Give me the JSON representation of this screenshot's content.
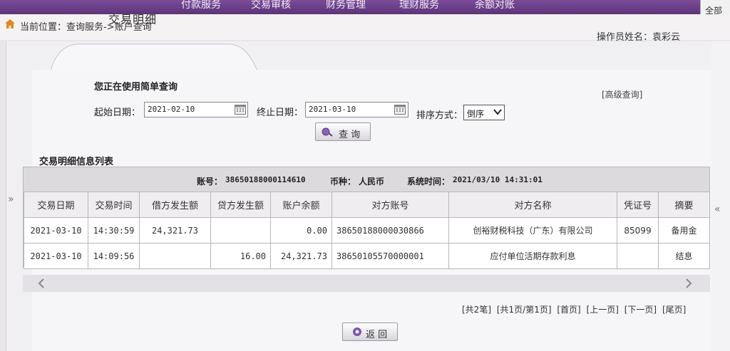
{
  "topnav": {
    "items": [
      "付款服务",
      "交易审核",
      "财务管理",
      "理财服务",
      "余额对账"
    ],
    "right_label": "全部"
  },
  "breadcrumb": {
    "text": "当前位置：查询服务->账户查询"
  },
  "operator": "操作员姓名：袁彩云",
  "tab": {
    "title": "交易明细"
  },
  "query": {
    "mode_note": "您正在使用简单查询",
    "advanced_link": "[高级查询]",
    "start_label": "起始日期：",
    "start_value": "2021-02-10",
    "end_label": "终止日期：",
    "end_value": "2021-03-10",
    "sort_label": "排序方式：",
    "sort_value": "倒序",
    "search_button": "查 询"
  },
  "list": {
    "section_title": "交易明细信息列表",
    "account_label": "账号：",
    "account_value": "38650188000114610",
    "currency_label": "币种：",
    "currency_value": "人民币",
    "systime_label": "系统时间：",
    "systime_value": "2021/03/10 14:31:01",
    "columns": [
      "交易日期",
      "交易时间",
      "借方发生额",
      "贷方发生额",
      "账户余额",
      "对方账号",
      "对方名称",
      "凭证号",
      "摘要"
    ],
    "rows": [
      {
        "date": "2021-03-10",
        "time": "14:30:59",
        "debit": "24,321.73",
        "credit": "",
        "balance": "0.00",
        "counter_account": "38650188000030866",
        "counter_name": "创裕财税科技（广东）有限公司",
        "voucher": "85099",
        "summary": "备用金"
      },
      {
        "date": "2021-03-10",
        "time": "14:09:56",
        "debit": "",
        "credit": "16.00",
        "balance": "24,321.73",
        "counter_account": "38650105570000001",
        "counter_name": "应付单位活期存款利息",
        "voucher": "",
        "summary": "结息"
      }
    ]
  },
  "pager": {
    "total": "[共2笔]",
    "pages": "[共1页/第1页]",
    "first": "[首页]",
    "prev": "[上一页]",
    "next": "[下一页]",
    "last": "[尾页]"
  },
  "back_button": "返 回",
  "side_arrows": {
    "left": "»",
    "right": "«"
  },
  "colors": {
    "nav": "#6b3f8a",
    "panel": "#f0eff1"
  }
}
